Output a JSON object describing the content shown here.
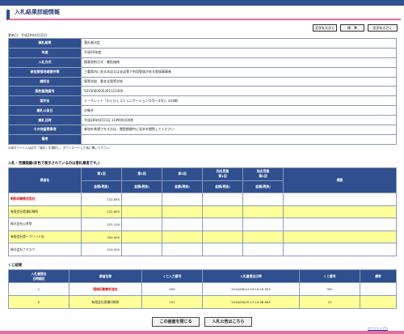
{
  "page_title": "入札結果詳細情報",
  "font_buttons": [
    "文字を大きく",
    "標　準",
    "文字を小さく"
  ],
  "update_date": "更新日：平成28年6月20日",
  "info_rows": [
    {
      "label": "開札結果",
      "value": "落札者決定"
    },
    {
      "label": "年度",
      "value": "平成28年度"
    },
    {
      "label": "入札方式",
      "value": "随意契約方式・最低価格"
    },
    {
      "label": "参加資格地域要件等",
      "value": "三重県内にある本店又は支店等で利用登録がある登録事業者"
    },
    {
      "label": "課所名",
      "value": "奥等学校　桑名北奥等学校"
    },
    {
      "label": "契約管理番号",
      "value": "5015000005261515405"
    },
    {
      "label": "案件名",
      "value": "リーフレット「わくわくコミュニケーション(1号〜3号)」の印刷"
    },
    {
      "label": "開札公告日",
      "value": "対象外"
    },
    {
      "label": "開札日時",
      "value": "平成28年6月15日 11時00分00秒"
    },
    {
      "label": "その他留意事項",
      "value": "参加を希望される方は、閲覧期間中に見本を閲覧してください"
    },
    {
      "label": "備考",
      "value": ""
    }
  ],
  "attachment_note": "※添付ファイルは必ず「保存」を選択し、ダウンロードした後に開いて下さい。",
  "bid_section_title": "入札・見積経緯(赤色で表示されているのは落札業者です。)",
  "bid_headers": {
    "company": "業者名",
    "round1": "第1回",
    "round2": "第2回",
    "round3": "第3回",
    "desig1": "指名見積\n第1回",
    "desig2": "指名見積\n第2回",
    "remarks": "摘要",
    "sub": "金額(税抜)"
  },
  "bid_rows": [
    {
      "company": "昭和印刷株式会社",
      "amount": "122,850",
      "winner": true
    },
    {
      "company": "有限会社奥瀬印刷所",
      "amount": "122,850",
      "winner": false
    },
    {
      "company": "株式会社山幸堂",
      "amount": "251,100",
      "winner": false
    },
    {
      "company": "有限会社第一プリント社",
      "amount": "300,000",
      "winner": false
    },
    {
      "company": "株式会社ナミカワ",
      "amount": "324,000",
      "winner": false
    }
  ],
  "lot_section_title": "くじ結果",
  "lot_headers": [
    "入札書提出\n日時順位",
    "業者名称",
    "くじ入力番号",
    "入札書提出日時",
    "くじ番号",
    "備考"
  ],
  "lot_rows": [
    {
      "rank": "1",
      "company": "昭和印刷株式会社",
      "input_no": "009",
      "datetime": "2016/06/14 19:10:16.303",
      "lot_no": "392",
      "note": "",
      "winner": true
    },
    {
      "rank": "0",
      "company": "有限会社奥瀬印刷所",
      "input_no": "152",
      "datetime": "2016/06/09 17:10:58.863",
      "lot_no": "15",
      "note": "",
      "winner": false
    }
  ],
  "buttons": {
    "close": "この画面を閉じる",
    "notice": "入札公告はこちら"
  },
  "page_top": "ページトップへ"
}
